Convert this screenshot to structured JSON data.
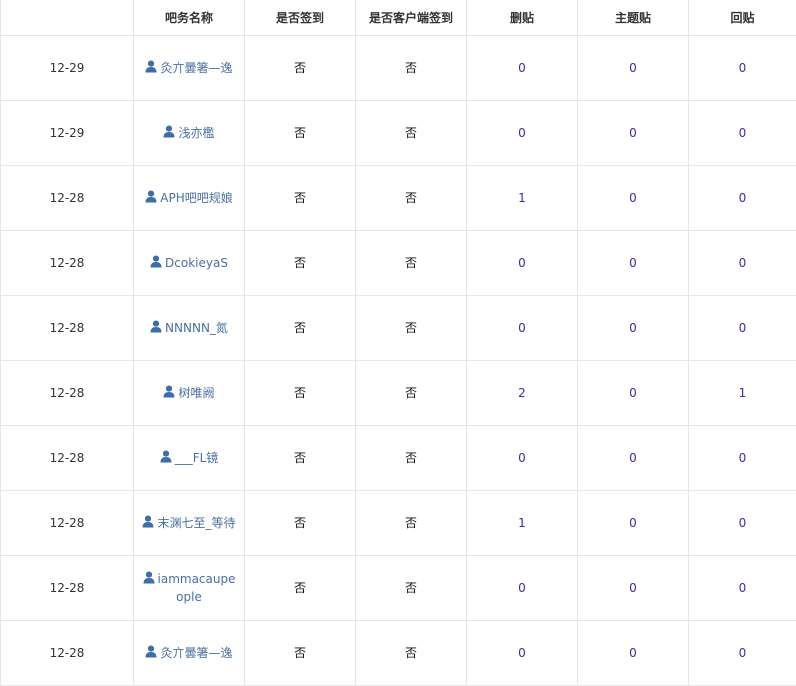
{
  "table": {
    "headers": [
      "",
      "吧务名称",
      "是否签到",
      "是否客户端签到",
      "删贴",
      "主题贴",
      "回贴"
    ],
    "rows": [
      {
        "date": "12-29",
        "name": "灸亣曇箸—逸",
        "signed": "否",
        "client_signed": "否",
        "deleted": "0",
        "threads": "0",
        "replies": "0"
      },
      {
        "date": "12-29",
        "name": "浅亦檻",
        "signed": "否",
        "client_signed": "否",
        "deleted": "0",
        "threads": "0",
        "replies": "0"
      },
      {
        "date": "12-28",
        "name": "APH吧吧规娘",
        "signed": "否",
        "client_signed": "否",
        "deleted": "1",
        "threads": "0",
        "replies": "0"
      },
      {
        "date": "12-28",
        "name": "DcokieyaS",
        "signed": "否",
        "client_signed": "否",
        "deleted": "0",
        "threads": "0",
        "replies": "0"
      },
      {
        "date": "12-28",
        "name": "NNNNN_氮",
        "signed": "否",
        "client_signed": "否",
        "deleted": "0",
        "threads": "0",
        "replies": "0"
      },
      {
        "date": "12-28",
        "name": "树唯阙",
        "signed": "否",
        "client_signed": "否",
        "deleted": "2",
        "threads": "0",
        "replies": "1"
      },
      {
        "date": "12-28",
        "name": "___FL镜",
        "signed": "否",
        "client_signed": "否",
        "deleted": "0",
        "threads": "0",
        "replies": "0"
      },
      {
        "date": "12-28",
        "name": "末渊七至_等待",
        "signed": "否",
        "client_signed": "否",
        "deleted": "1",
        "threads": "0",
        "replies": "0"
      },
      {
        "date": "12-28",
        "name": "iammacaupeople",
        "signed": "否",
        "client_signed": "否",
        "deleted": "0",
        "threads": "0",
        "replies": "0"
      },
      {
        "date": "12-28",
        "name": "灸亣曇箸—逸",
        "signed": "否",
        "client_signed": "否",
        "deleted": "0",
        "threads": "0",
        "replies": "0"
      }
    ]
  },
  "icons": {
    "user": "user-icon"
  },
  "colors": {
    "link": "#4a6fa0",
    "icon": "#3d6ea8",
    "number": "#333399",
    "border": "#e6e6e6"
  }
}
